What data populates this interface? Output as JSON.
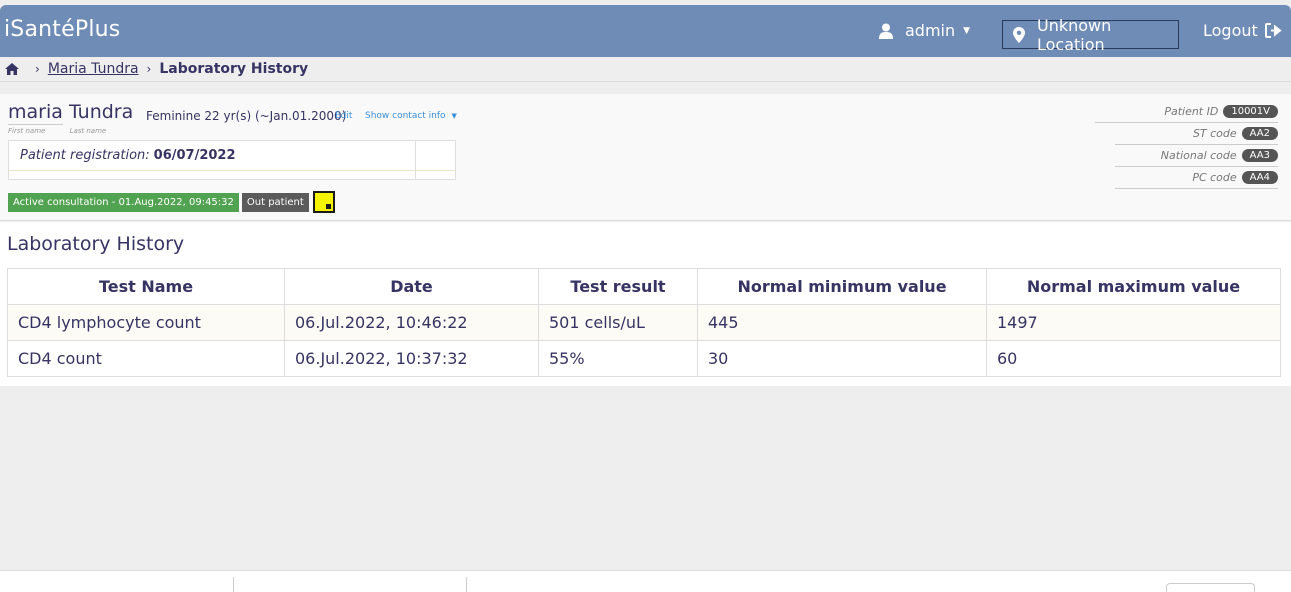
{
  "app": {
    "title": "iSantéPlus"
  },
  "header": {
    "user": "admin",
    "location": "Unknown Location",
    "logout": "Logout"
  },
  "breadcrumb": {
    "patient": "Maria Tundra",
    "current": "Laboratory History"
  },
  "patient": {
    "first_name": "maria",
    "last_name": "Tundra",
    "first_label": "First name",
    "last_label": "Last name",
    "gender_age": "Feminine  22 yr(s) (~Jan.01.2000)",
    "edit": "Edit",
    "contact": "Show contact info",
    "registration_label": "Patient registration:",
    "registration_date": "06/07/2022",
    "visit_badge": "Active consultation - 01.Aug.2022, 09:45:32",
    "visit_type": "Out patient",
    "ids": [
      {
        "label": "Patient ID",
        "value": "10001V"
      },
      {
        "label": "ST code",
        "value": "AA2"
      },
      {
        "label": "National code",
        "value": "AA3"
      },
      {
        "label": "PC code",
        "value": "AA4"
      }
    ]
  },
  "main": {
    "title": "Laboratory History",
    "columns": [
      "Test Name",
      "Date",
      "Test result",
      "Normal minimum value",
      "Normal maximum value"
    ],
    "rows": [
      [
        "CD4 lymphocyte count",
        "06.Jul.2022, 10:46:22",
        "501 cells/uL",
        "445",
        "1497"
      ],
      [
        "CD4 count",
        "06.Jul.2022, 10:37:32",
        "55%",
        "30",
        "60"
      ]
    ]
  },
  "colors": {
    "header": "#6f8cb7",
    "text": "#363463",
    "active_badge": "#51a351",
    "note": "#f4f400"
  },
  "icons": [
    "user-icon",
    "map-marker-icon",
    "sign-out-icon",
    "home-icon",
    "chevron-right-icon",
    "sticky-note-icon"
  ]
}
